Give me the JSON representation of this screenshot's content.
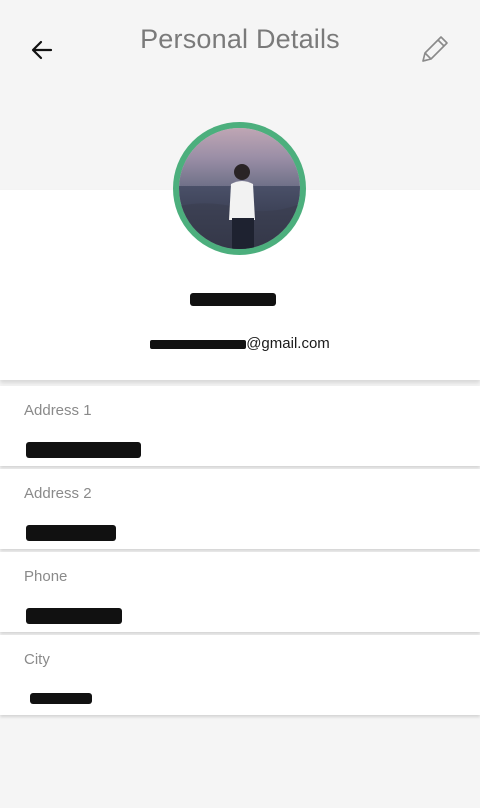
{
  "header": {
    "title": "Personal Details",
    "back_icon": "arrow-left-icon",
    "edit_icon": "pencil-icon"
  },
  "profile": {
    "email_suffix": "@gmail.com",
    "avatar_ring_color": "#4caf7d"
  },
  "fields": [
    {
      "label": "Address 1"
    },
    {
      "label": "Address 2"
    },
    {
      "label": "Phone"
    },
    {
      "label": "City"
    }
  ]
}
